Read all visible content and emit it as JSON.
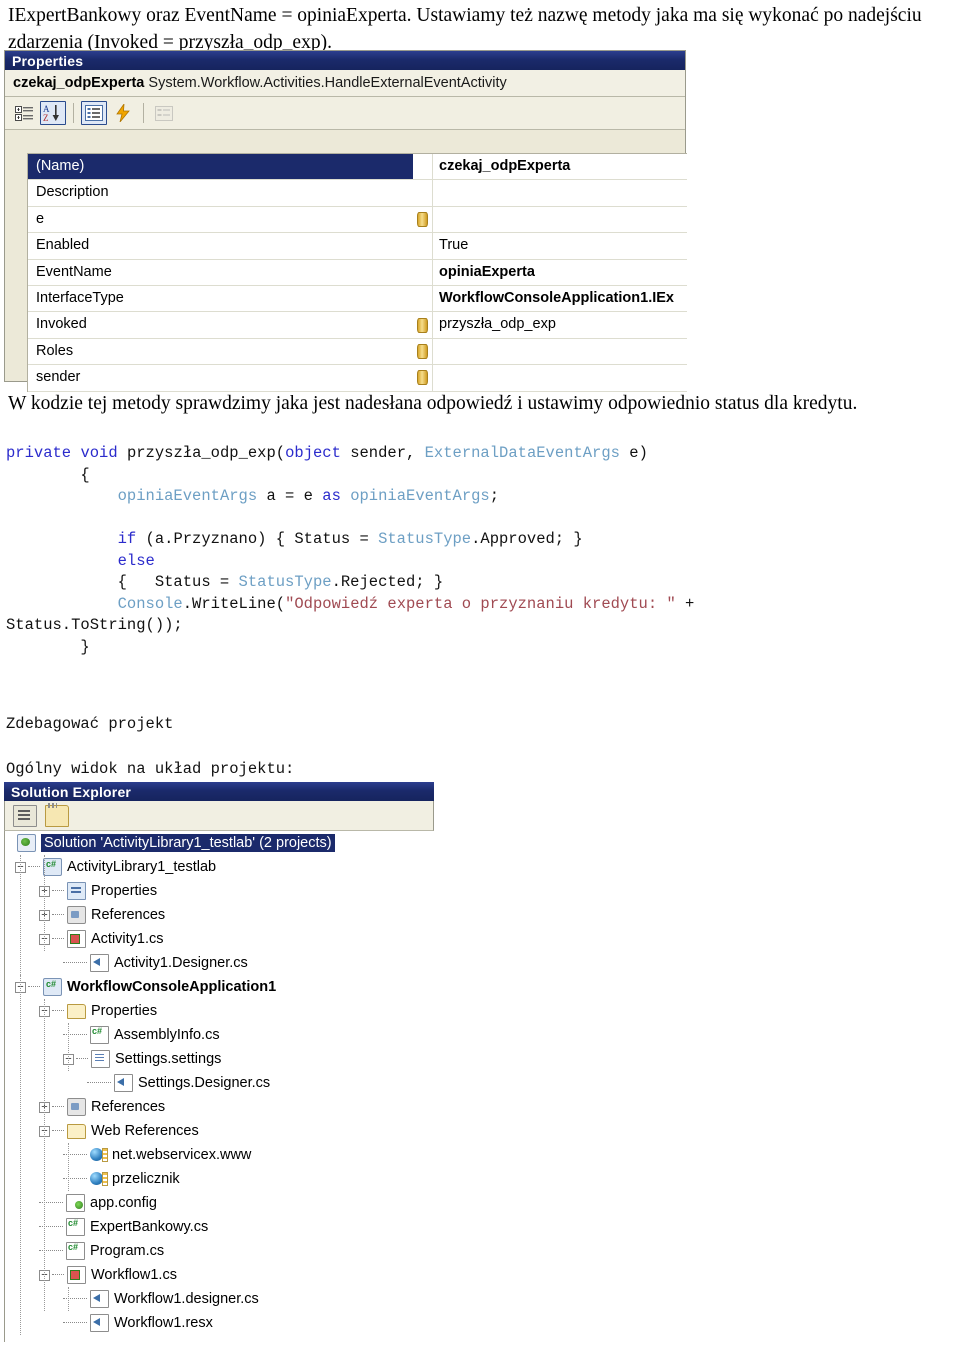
{
  "intro_paragraph": "IExpertBankowy oraz EventName = opiniaExperta. Ustawiamy też nazwę metody jaka ma się wykonać po nadejściu zdarzenia (Invoked = przyszła_odp_exp).",
  "body_paragraph": "W kodzie tej metody sprawdzimy jaka jest nadesłana odpowiedź i ustawimy odpowiednio status dla kredytu.",
  "properties_window": {
    "title": "Properties",
    "object_name": "czekaj_odpExperta",
    "object_type": "System.Workflow.Activities.HandleExternalEventActivity",
    "toolbar": [
      {
        "name": "categorized-view-button",
        "tooltip": "Categorized",
        "pressed": false
      },
      {
        "name": "alphabetical-sort-button",
        "tooltip": "Alphabetical",
        "pressed": true
      },
      {
        "name": "properties-view-button",
        "tooltip": "Properties",
        "pressed": true
      },
      {
        "name": "events-view-button",
        "tooltip": "Events",
        "pressed": false
      },
      {
        "name": "property-pages-button",
        "tooltip": "Property Pages",
        "pressed": false
      }
    ],
    "rows": [
      {
        "name": "(Name)",
        "value": "czekaj_odpExperta",
        "bold": true,
        "binding": false,
        "selected": true
      },
      {
        "name": "Description",
        "value": "",
        "bold": false,
        "binding": false,
        "selected": false
      },
      {
        "name": "e",
        "value": "",
        "bold": false,
        "binding": true,
        "selected": false
      },
      {
        "name": "Enabled",
        "value": "True",
        "bold": false,
        "binding": false,
        "selected": false
      },
      {
        "name": "EventName",
        "value": "opiniaExperta",
        "bold": true,
        "binding": false,
        "selected": false
      },
      {
        "name": "InterfaceType",
        "value": "WorkflowConsoleApplication1.IEx",
        "bold": true,
        "binding": false,
        "selected": false
      },
      {
        "name": "Invoked",
        "value": "przyszła_odp_exp",
        "bold": false,
        "binding": true,
        "selected": false
      },
      {
        "name": "Roles",
        "value": "",
        "bold": false,
        "binding": true,
        "selected": false
      },
      {
        "name": "sender",
        "value": "",
        "bold": false,
        "binding": true,
        "selected": false
      }
    ]
  },
  "code": {
    "lines": [
      [
        {
          "t": "k",
          "s": "private"
        },
        {
          "t": "p",
          "s": " "
        },
        {
          "t": "k",
          "s": "void"
        },
        {
          "t": "p",
          "s": " przyszła_odp_exp("
        },
        {
          "t": "k",
          "s": "object"
        },
        {
          "t": "p",
          "s": " sender, "
        },
        {
          "t": "t",
          "s": "ExternalDataEventArgs"
        },
        {
          "t": "p",
          "s": " e)"
        }
      ],
      [
        {
          "t": "p",
          "s": "        {"
        }
      ],
      [
        {
          "t": "p",
          "s": "            "
        },
        {
          "t": "t",
          "s": "opiniaEventArgs"
        },
        {
          "t": "p",
          "s": " a = e "
        },
        {
          "t": "k",
          "s": "as"
        },
        {
          "t": "p",
          "s": " "
        },
        {
          "t": "t",
          "s": "opiniaEventArgs"
        },
        {
          "t": "p",
          "s": ";"
        }
      ],
      [
        {
          "t": "p",
          "s": ""
        }
      ],
      [
        {
          "t": "p",
          "s": "            "
        },
        {
          "t": "k",
          "s": "if"
        },
        {
          "t": "p",
          "s": " (a.Przyznano) { Status = "
        },
        {
          "t": "t",
          "s": "StatusType"
        },
        {
          "t": "p",
          "s": ".Approved; }"
        }
      ],
      [
        {
          "t": "p",
          "s": "            "
        },
        {
          "t": "k",
          "s": "else"
        }
      ],
      [
        {
          "t": "p",
          "s": "            {   Status = "
        },
        {
          "t": "t",
          "s": "StatusType"
        },
        {
          "t": "p",
          "s": ".Rejected; }"
        }
      ],
      [
        {
          "t": "p",
          "s": "            "
        },
        {
          "t": "t",
          "s": "Console"
        },
        {
          "t": "p",
          "s": ".WriteLine("
        },
        {
          "t": "s",
          "s": "\"Odpowiedź experta o przyznaniu kredytu: \""
        },
        {
          "t": "p",
          "s": " +"
        }
      ],
      [
        {
          "t": "p",
          "s": "Status.ToString());"
        }
      ],
      [
        {
          "t": "p",
          "s": "        }"
        }
      ]
    ]
  },
  "notes": {
    "debug": "Zdebagować projekt",
    "overview": "Ogólny widok na układ projektu:"
  },
  "solution_explorer": {
    "title": "Solution Explorer",
    "toolbar": [
      {
        "name": "properties-button",
        "tooltip": "Properties"
      },
      {
        "name": "show-all-files-button",
        "tooltip": "Show All Files"
      }
    ],
    "tree": [
      {
        "label": "Solution 'ActivityLibrary1_testlab' (2 projects)",
        "indent": 0,
        "expander": "none",
        "icon": "solution-icon",
        "bold": false,
        "selected": true
      },
      {
        "label": "ActivityLibrary1_testlab",
        "indent": 0,
        "expander": "minus",
        "icon": "csharp-project-icon",
        "bold": false,
        "selected": false
      },
      {
        "label": "Properties",
        "indent": 1,
        "expander": "plus",
        "icon": "properties-page-icon",
        "bold": false,
        "selected": false
      },
      {
        "label": "References",
        "indent": 1,
        "expander": "plus",
        "icon": "references-icon",
        "bold": false,
        "selected": false
      },
      {
        "label": "Activity1.cs",
        "indent": 1,
        "expander": "minus",
        "icon": "activity-icon",
        "bold": false,
        "selected": false
      },
      {
        "label": "Activity1.Designer.cs",
        "indent": 2,
        "expander": "leaf",
        "icon": "designer-file-icon",
        "bold": false,
        "selected": false
      },
      {
        "label": "WorkflowConsoleApplication1",
        "indent": 0,
        "expander": "minus",
        "icon": "csharp-project-icon",
        "bold": true,
        "selected": false
      },
      {
        "label": "Properties",
        "indent": 1,
        "expander": "minus",
        "icon": "folder-open-icon",
        "bold": false,
        "selected": false
      },
      {
        "label": "AssemblyInfo.cs",
        "indent": 2,
        "expander": "leaf",
        "icon": "csharp-file-icon",
        "bold": false,
        "selected": false
      },
      {
        "label": "Settings.settings",
        "indent": 2,
        "expander": "minus",
        "icon": "settings-file-icon",
        "bold": false,
        "selected": false
      },
      {
        "label": "Settings.Designer.cs",
        "indent": 3,
        "expander": "leaf",
        "icon": "designer-file-icon",
        "bold": false,
        "selected": false
      },
      {
        "label": "References",
        "indent": 1,
        "expander": "plus",
        "icon": "references-icon",
        "bold": false,
        "selected": false
      },
      {
        "label": "Web References",
        "indent": 1,
        "expander": "minus",
        "icon": "folder-open-icon",
        "bold": false,
        "selected": false
      },
      {
        "label": "net.webservicex.www",
        "indent": 2,
        "expander": "leaf",
        "icon": "web-reference-icon",
        "bold": false,
        "selected": false
      },
      {
        "label": "przelicznik",
        "indent": 2,
        "expander": "leaf",
        "icon": "web-reference-icon",
        "bold": false,
        "selected": false
      },
      {
        "label": "app.config",
        "indent": 1,
        "expander": "leaf",
        "icon": "config-file-icon",
        "bold": false,
        "selected": false
      },
      {
        "label": "ExpertBankowy.cs",
        "indent": 1,
        "expander": "leaf",
        "icon": "csharp-file-icon",
        "bold": false,
        "selected": false
      },
      {
        "label": "Program.cs",
        "indent": 1,
        "expander": "leaf",
        "icon": "csharp-file-icon",
        "bold": false,
        "selected": false
      },
      {
        "label": "Workflow1.cs",
        "indent": 1,
        "expander": "minus",
        "icon": "activity-icon",
        "bold": false,
        "selected": false
      },
      {
        "label": "Workflow1.designer.cs",
        "indent": 2,
        "expander": "leaf",
        "icon": "designer-file-icon",
        "bold": false,
        "selected": false
      },
      {
        "label": "Workflow1.resx",
        "indent": 2,
        "expander": "leaf",
        "icon": "designer-file-icon",
        "bold": false,
        "selected": false
      }
    ]
  },
  "colors": {
    "titlebar": "#1b2a6b",
    "panel_bg": "#ece9d8",
    "keyword": "#2b2bcc",
    "type": "#6d9fc4",
    "string": "#a04a52",
    "selection": "#1b2a6b"
  }
}
